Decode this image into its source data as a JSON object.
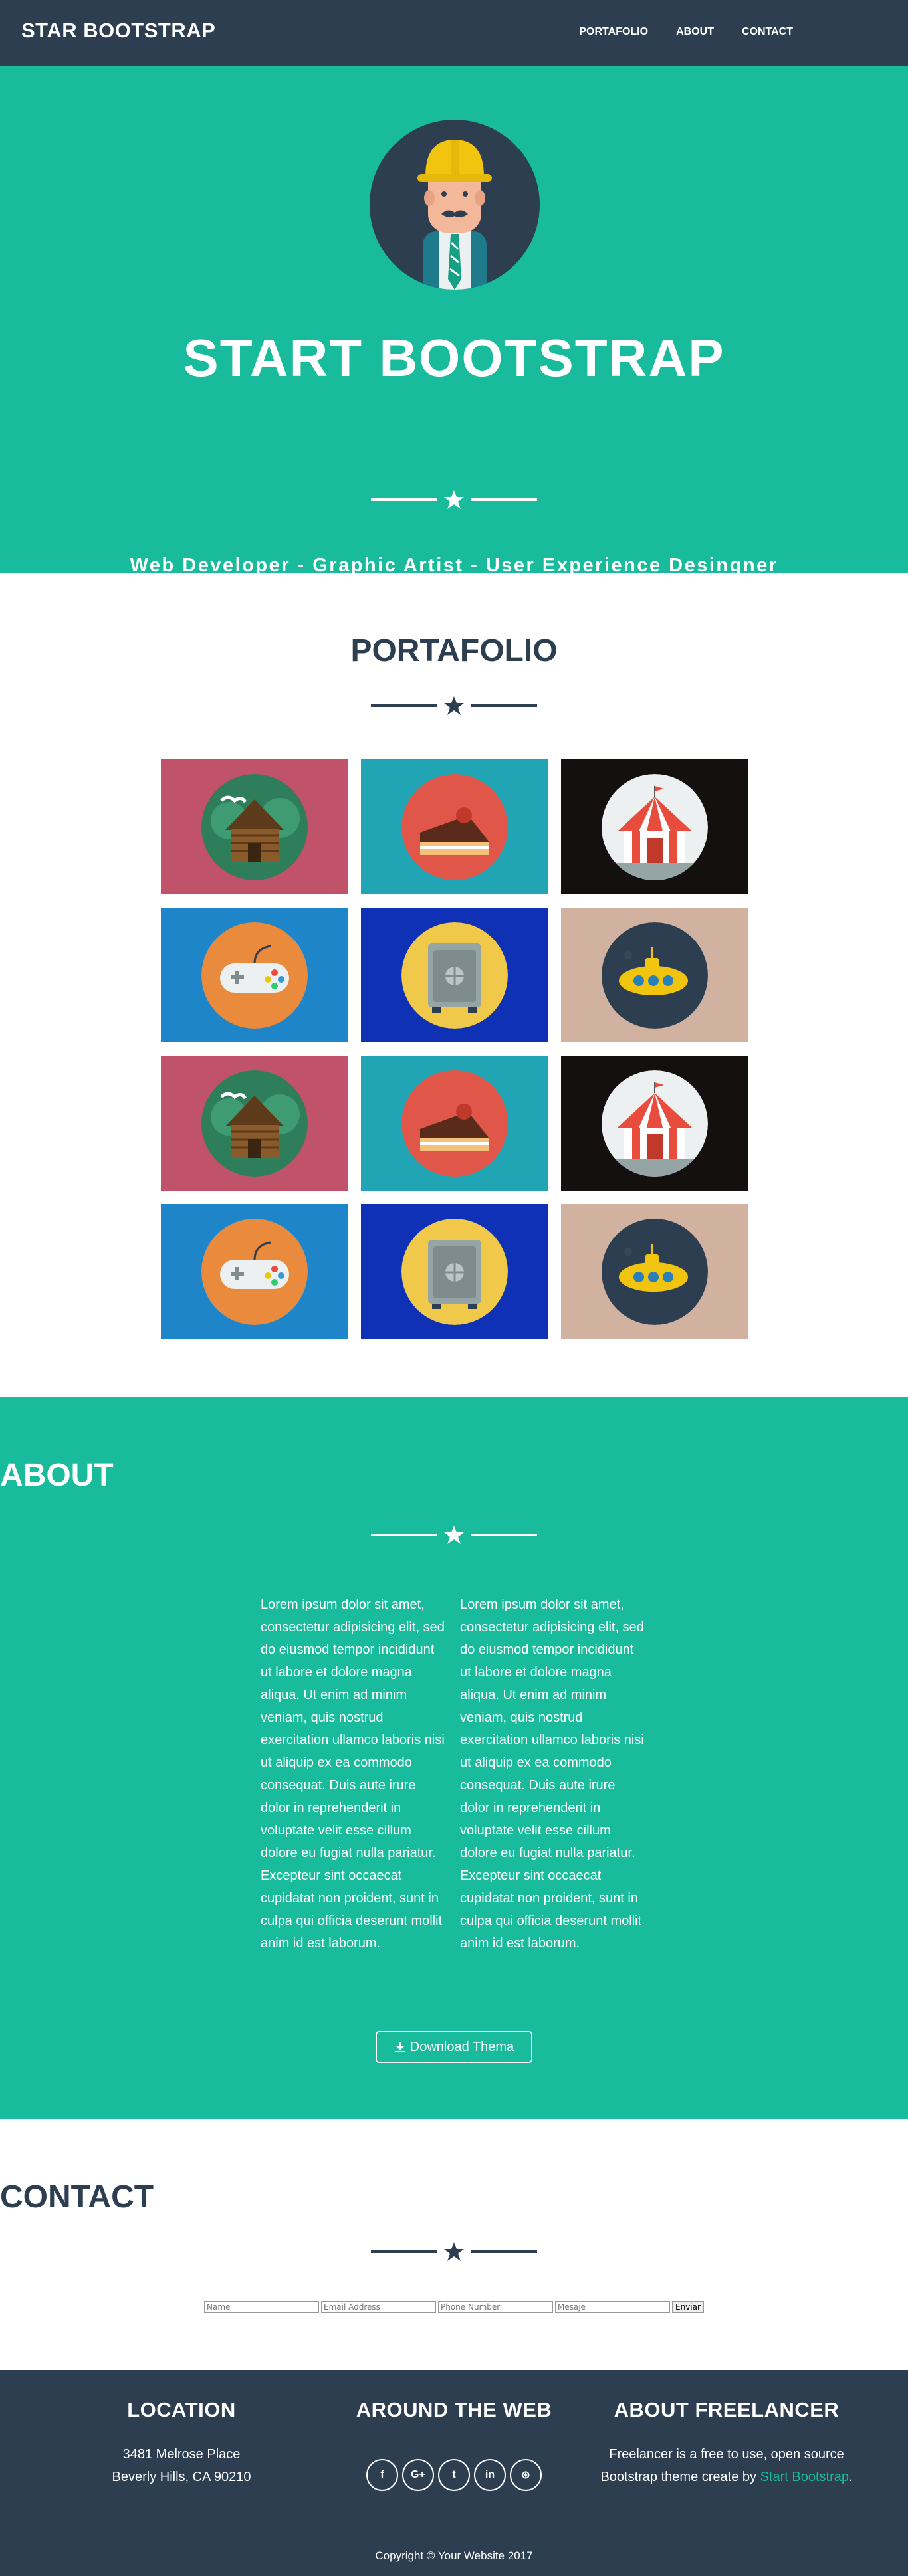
{
  "navbar": {
    "brand": "STAR BOOTSTRAP",
    "links": [
      "PORTAFOLIO",
      "ABOUT",
      "CONTACT"
    ]
  },
  "hero": {
    "title": "START BOOTSTRAP",
    "subtitle": "Web Developer - Graphic Artist - User Experience Desingner"
  },
  "portfolio": {
    "title": "PORTAFOLIO",
    "items": [
      {
        "icon": "cabin-icon",
        "bg": "#c0526a"
      },
      {
        "icon": "cake-icon",
        "bg": "#21a5b5"
      },
      {
        "icon": "circus-tent-icon",
        "bg": "#141010"
      },
      {
        "icon": "game-controller-icon",
        "bg": "#1f85c9"
      },
      {
        "icon": "safe-icon",
        "bg": "#0f31b5"
      },
      {
        "icon": "submarine-icon",
        "bg": "#d1b2a1"
      },
      {
        "icon": "cabin-icon",
        "bg": "#c0526a"
      },
      {
        "icon": "cake-icon",
        "bg": "#21a5b5"
      },
      {
        "icon": "circus-tent-icon",
        "bg": "#141010"
      },
      {
        "icon": "game-controller-icon",
        "bg": "#1f85c9"
      },
      {
        "icon": "safe-icon",
        "bg": "#0f31b5"
      },
      {
        "icon": "submarine-icon",
        "bg": "#d1b2a1"
      }
    ]
  },
  "about": {
    "title": "ABOUT",
    "col1": "Lorem ipsum dolor sit amet, consectetur adipisicing elit, sed do eiusmod tempor incididunt ut labore et dolore magna aliqua. Ut enim ad minim veniam, quis nostrud exercitation ullamco laboris nisi ut aliquip ex ea commodo consequat. Duis aute irure dolor in reprehenderit in voluptate velit esse cillum dolore eu fugiat nulla pariatur. Excepteur sint occaecat cupidatat non proident, sunt in culpa qui officia deserunt mollit anim id est laborum.",
    "col2": "Lorem ipsum dolor sit amet, consectetur adipisicing elit, sed do eiusmod tempor incididunt ut labore et dolore magna aliqua. Ut enim ad minim veniam, quis nostrud exercitation ullamco laboris nisi ut aliquip ex ea commodo consequat. Duis aute irure dolor in reprehenderit in voluptate velit esse cillum dolore eu fugiat nulla pariatur. Excepteur sint occaecat cupidatat non proident, sunt in culpa qui officia deserunt mollit anim id est laborum.",
    "download_label": "Download Thema"
  },
  "contact": {
    "title": "CONTACT",
    "name_placeholder": "Name",
    "email_placeholder": "Email Address",
    "phone_placeholder": "Phone Number",
    "message_placeholder": "Mesaje",
    "submit_label": "Enviar"
  },
  "footer": {
    "location_title": "LOCATION",
    "address_line1": "3481 Melrose Place",
    "address_line2": "Beverly Hills, CA 90210",
    "web_title": "AROUND THE WEB",
    "socials": [
      {
        "icon": "facebook-icon",
        "glyph": "f"
      },
      {
        "icon": "google-plus-icon",
        "glyph": "G+"
      },
      {
        "icon": "twitter-icon",
        "glyph": "t"
      },
      {
        "icon": "linkedin-icon",
        "glyph": "in"
      },
      {
        "icon": "dribbble-icon",
        "glyph": "⊛"
      }
    ],
    "freelancer_title": "ABOUT FREELANCER",
    "freelancer_text": "Freelancer is a free to use, open source Bootstrap theme create by",
    "freelancer_link": "Start Bootstrap",
    "freelancer_end": ".",
    "copyright": "Copyright © Your Website 2017"
  },
  "colors": {
    "primary": "#2c3e50",
    "accent": "#18bc9c",
    "white": "#ffffff"
  }
}
